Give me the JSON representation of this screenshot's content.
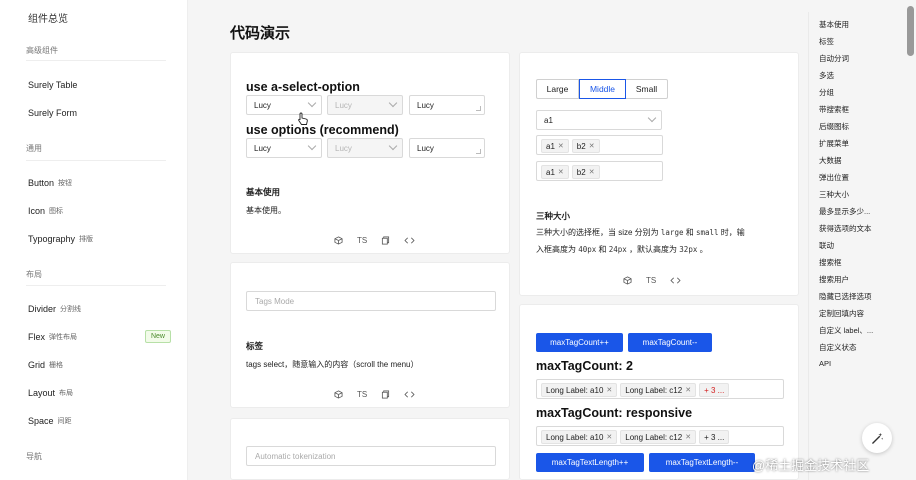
{
  "sidebar": {
    "top": "组件总览",
    "groups": {
      "advanced": "高级组件",
      "general": "通用",
      "layout": "布局",
      "nav": "导航"
    },
    "items": {
      "surely_table": "Surely Table",
      "surely_form": "Surely Form",
      "button": {
        "label": "Button",
        "zh": "按钮"
      },
      "icon": {
        "label": "Icon",
        "zh": "图标"
      },
      "typography": {
        "label": "Typography",
        "zh": "排版"
      },
      "divider": {
        "label": "Divider",
        "zh": "分割线"
      },
      "flex": {
        "label": "Flex",
        "zh": "弹性布局",
        "badge": "New"
      },
      "grid": {
        "label": "Grid",
        "zh": "栅格"
      },
      "layout": {
        "label": "Layout",
        "zh": "布局"
      },
      "space": {
        "label": "Space",
        "zh": "间距"
      }
    }
  },
  "main": {
    "title": "代码演示",
    "card1": {
      "h1": "use a-select-option",
      "h2": "use options (recommend)",
      "value": "Lucy",
      "demo_title": "基本使用",
      "demo_desc": "基本使用。",
      "ts": "TS"
    },
    "card2": {
      "placeholder": "Tags Mode",
      "demo_title": "标签",
      "demo_desc": "tags select，随意输入的内容（scroll the menu）",
      "ts": "TS"
    },
    "card3": {
      "placeholder": "Automatic tokenization"
    },
    "card4": {
      "sizes": [
        "Large",
        "Middle",
        "Small"
      ],
      "single_value": "a1",
      "tags": [
        "a1",
        "b2"
      ],
      "demo_title": "三种大小",
      "desc_1": "三种大小的选择框，当 size 分别为",
      "code_large": "large",
      "desc_and": "和",
      "code_small": "small",
      "desc_2": "时，输",
      "desc_3": "入框高度为",
      "code_40": "40px",
      "code_24": "24px",
      "desc_4": "，默认高度为",
      "code_32": "32px",
      "desc_end": "。",
      "ts": "TS"
    },
    "card5": {
      "btn_inc": "maxTagCount++",
      "btn_dec": "maxTagCount--",
      "h_count": "maxTagCount: 2",
      "tags_a": [
        "Long Label: a10",
        "Long Label: c12"
      ],
      "more_a": "+ 3 ...",
      "h_responsive": "maxTagCount: responsive",
      "more_b": "+ 3 ...",
      "btn_len_inc": "maxTagTextLength++",
      "btn_len_dec": "maxTagTextLength--"
    }
  },
  "toc": [
    "基本使用",
    "标签",
    "自动分词",
    "多选",
    "分组",
    "带搜索框",
    "后缀图标",
    "扩展菜单",
    "大数据",
    "弹出位置",
    "三种大小",
    "最多显示多少...",
    "获得选项的文本",
    "联动",
    "搜索框",
    "搜索用户",
    "隐藏已选择选项",
    "定制回填内容",
    "自定义 label、...",
    "自定义状态",
    "API"
  ],
  "watermark": "@稀土掘金技术社区",
  "colors": {
    "primary": "#1a56e8",
    "danger": "#d32020"
  }
}
